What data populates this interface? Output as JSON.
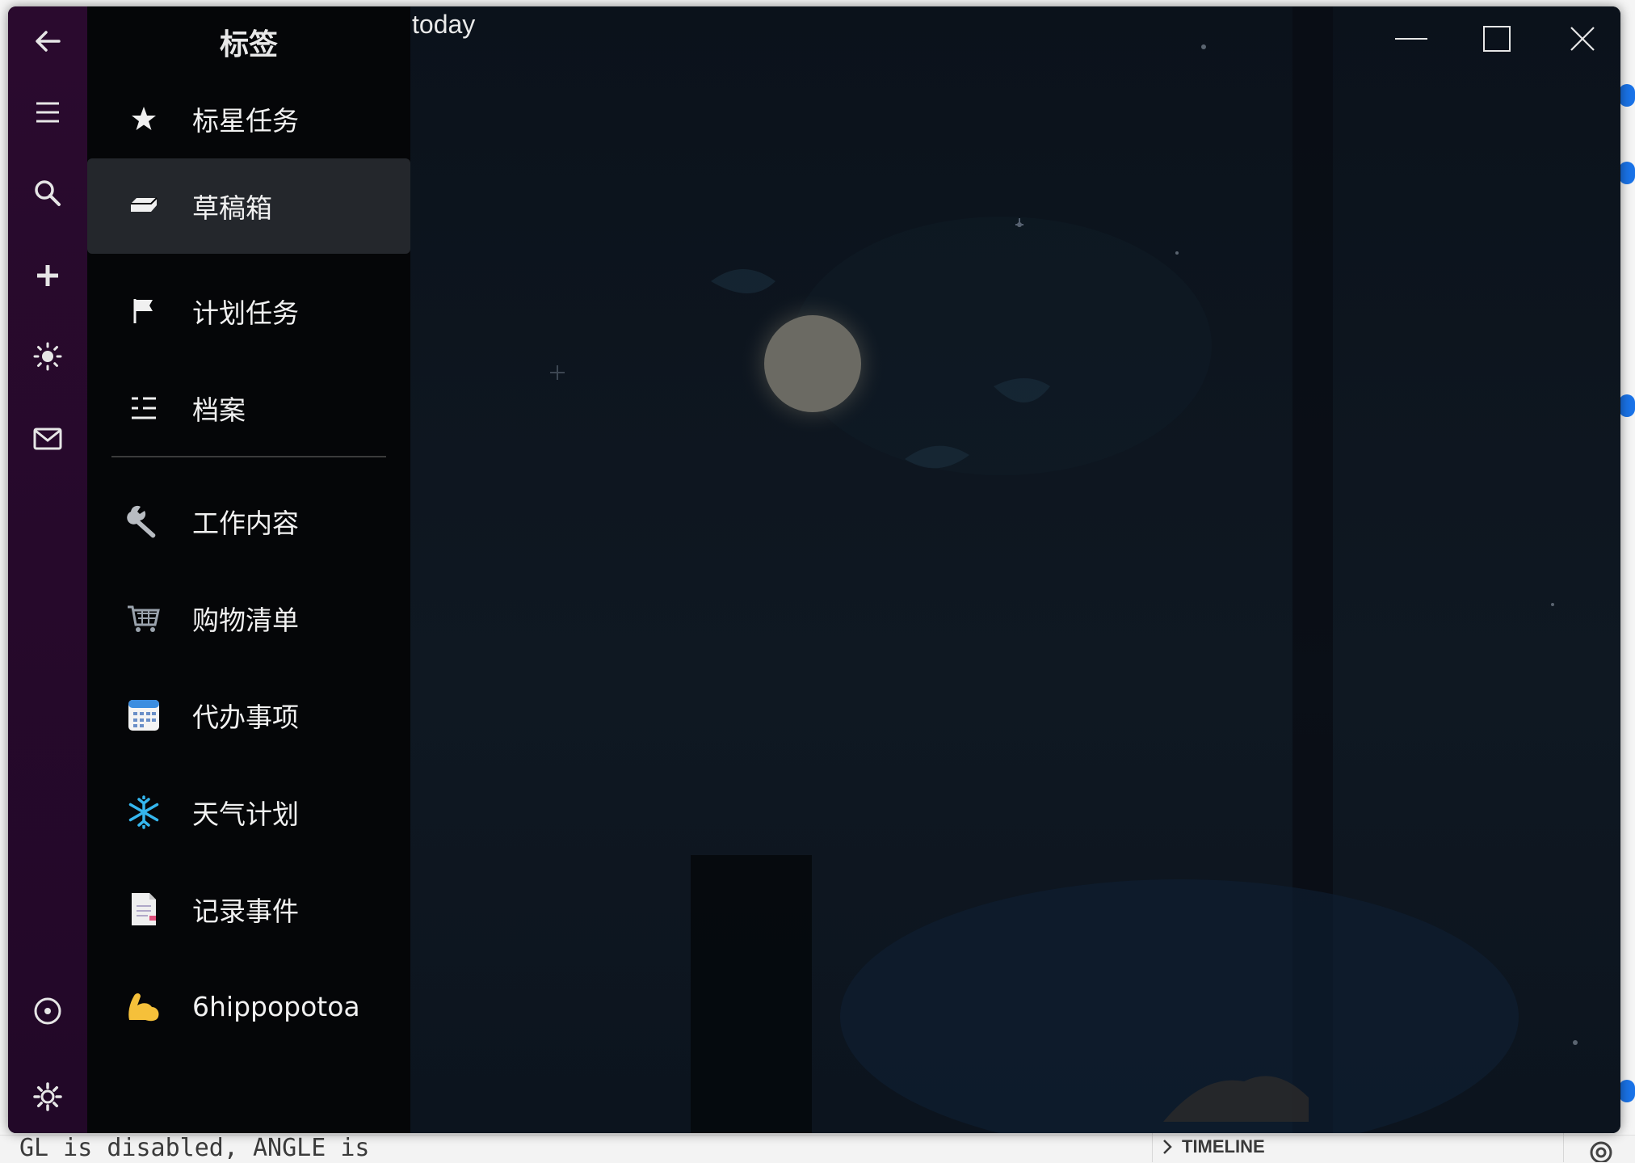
{
  "window": {
    "title": "today"
  },
  "panel": {
    "title": "标签",
    "items": [
      {
        "label": "标星任务",
        "icon": "star-icon"
      },
      {
        "label": "草稿箱",
        "icon": "inbox-tray-icon"
      },
      {
        "label": "计划任务",
        "icon": "flag-icon"
      },
      {
        "label": "档案",
        "icon": "list-icon"
      },
      {
        "label": "工作内容",
        "icon": "wrench-icon"
      },
      {
        "label": "购物清单",
        "icon": "shopping-cart-icon"
      },
      {
        "label": "代办事项",
        "icon": "calendar-icon"
      },
      {
        "label": "天气计划",
        "icon": "snowflake-icon"
      },
      {
        "label": "记录事件",
        "icon": "document-icon"
      },
      {
        "label": "6hippopotoa",
        "icon": "flexed-biceps-icon"
      }
    ],
    "selected_index": 1
  },
  "rail": {
    "icons": [
      "back-arrow-icon",
      "hamburger-menu-icon",
      "search-icon",
      "plus-icon",
      "sun-icon",
      "mail-icon",
      "target-icon",
      "settings-gear-icon"
    ]
  },
  "host": {
    "console_text": "GL is disabled, ANGLE is",
    "timeline_label": "TIMELINE"
  },
  "colors": {
    "rail_bg": "#2a0a2e",
    "panel_bg": "#050608",
    "selected_bg": "#24272c",
    "wallpaper": "#0d141d"
  }
}
